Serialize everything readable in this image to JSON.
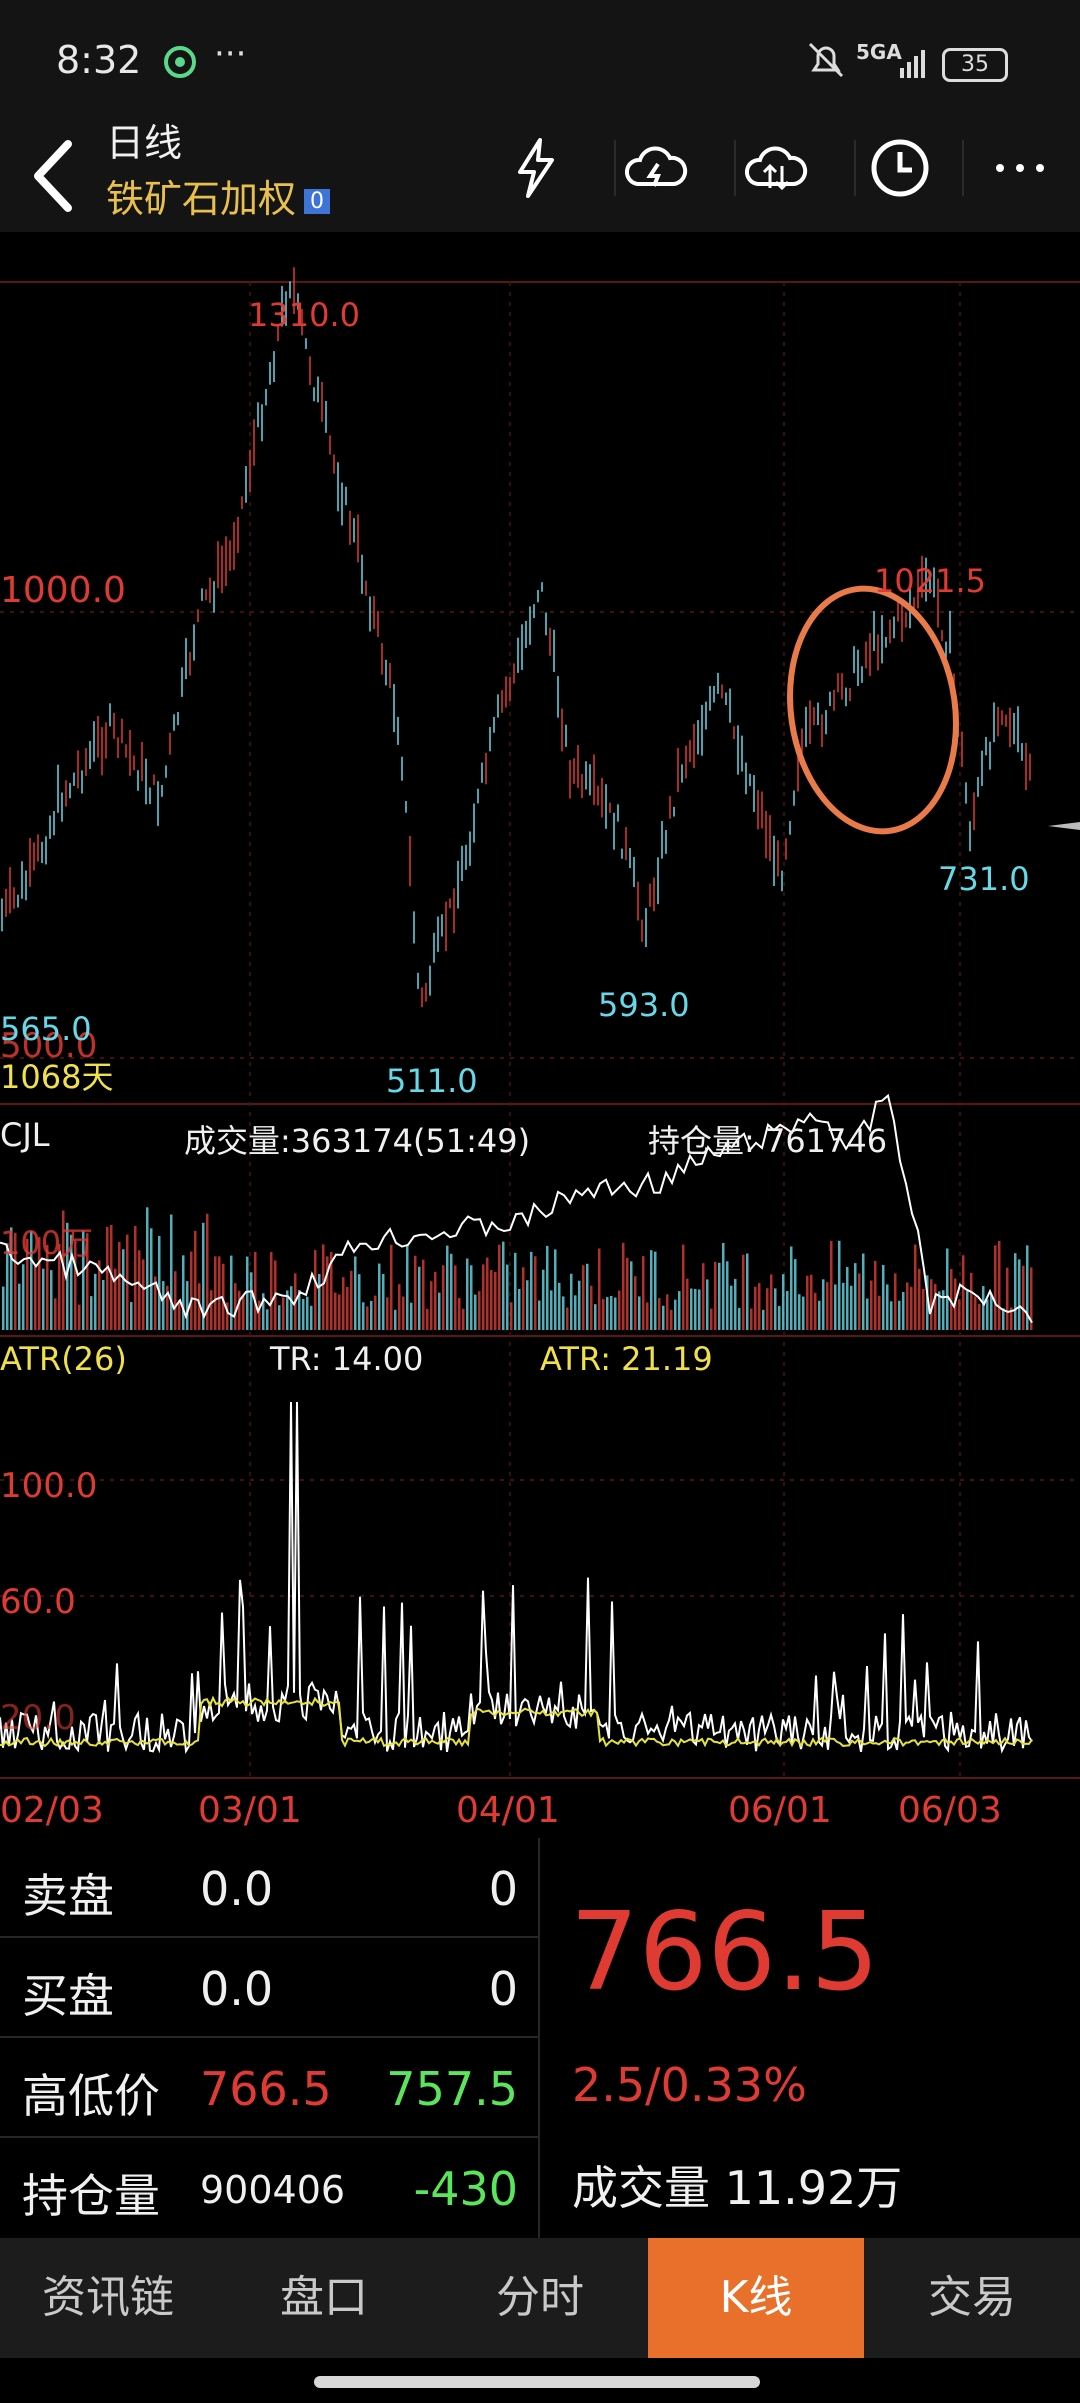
{
  "status_bar": {
    "time": "8:32",
    "network": "5GA",
    "battery": "35"
  },
  "header": {
    "title": "日线",
    "subtitle": "铁矿石加权",
    "badge": "0"
  },
  "main_chart": {
    "labels": {
      "high": "1310.0",
      "level_1000": "1000.0",
      "level_500": "500.0",
      "low_left": "565.0",
      "days": "1068天",
      "low_511": "511.0",
      "low_593": "593.0",
      "peak_1021": "1021.5",
      "low_731": "731.0"
    }
  },
  "volume_panel": {
    "name": "CJL",
    "volume_text": "成交量:363174(51:49)",
    "oi_text": "持仓量: 761746",
    "scale": "100万"
  },
  "atr_panel": {
    "name": "ATR(26)",
    "tr_text": "TR: 14.00",
    "atr_text": "ATR: 21.19",
    "level_100": "100.0",
    "level_60": "60.0",
    "level_20": "20.0"
  },
  "x_axis": [
    "02/03",
    "03/01",
    "04/01",
    "06/01",
    "06/03"
  ],
  "quote": {
    "sell": {
      "label": "卖盘",
      "price": "0.0",
      "qty": "0"
    },
    "buy": {
      "label": "买盘",
      "price": "0.0",
      "qty": "0"
    },
    "high_low": {
      "label": "高低价",
      "high": "766.5",
      "low": "757.5"
    },
    "oi": {
      "label": "持仓量",
      "value": "900406",
      "change": "-430"
    },
    "last": "766.5",
    "change": "2.5/0.33%",
    "volume": "成交量 11.92万"
  },
  "tabs": [
    "资讯链",
    "盘口",
    "分时",
    "K线",
    "交易"
  ],
  "active_tab": "K线",
  "colors": {
    "up": "#e03b33",
    "down": "#66d9e8",
    "accent": "#e9702a",
    "highlight": "#e8c04d"
  }
}
